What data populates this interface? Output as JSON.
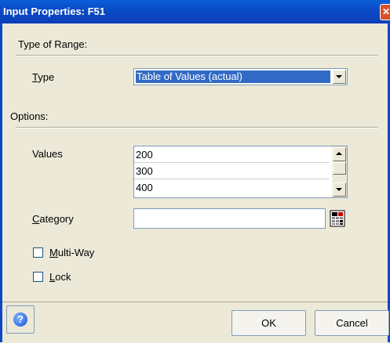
{
  "window": {
    "title": "Input Properties: F51",
    "close_icon": "close-icon"
  },
  "range_section": {
    "heading": "Type of Range:"
  },
  "type": {
    "label_prefix": "",
    "label_mnemonic": "T",
    "label_rest": "ype",
    "selected": "Table of Values (actual)"
  },
  "options_section": {
    "heading": "Options:"
  },
  "values": {
    "label": "Values",
    "items": [
      "200",
      "300",
      "400"
    ]
  },
  "category": {
    "label_mnemonic": "C",
    "label_rest": "ategory",
    "value": ""
  },
  "multiway": {
    "label_mnemonic": "M",
    "label_rest": "ulti-Way",
    "checked": false
  },
  "lock": {
    "label_mnemonic": "L",
    "label_rest": "ock",
    "checked": false
  },
  "buttons": {
    "ok": "OK",
    "cancel": "Cancel",
    "help": "?"
  },
  "colors": {
    "title_bar": "#0a49c5",
    "selection": "#316ac5",
    "dialog_bg": "#ece9d8"
  }
}
